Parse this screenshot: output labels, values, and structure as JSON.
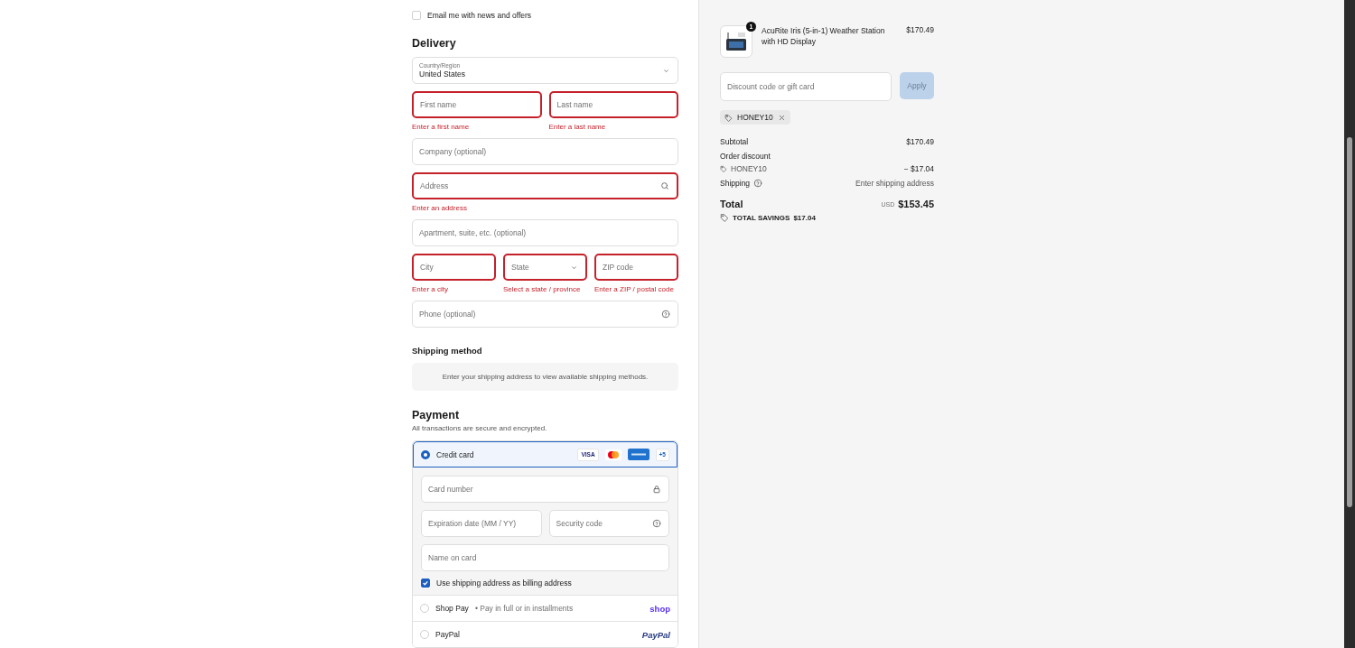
{
  "newsletter": {
    "label": "Email me with news and offers",
    "checked": false
  },
  "delivery": {
    "heading": "Delivery",
    "rows": [
      [
        {
          "kind": "select_labeled",
          "label": "Country/Region",
          "value": "United States",
          "invalid": false
        }
      ],
      [
        {
          "kind": "text",
          "placeholder": "First name",
          "invalid": true,
          "error": "Enter a first name"
        },
        {
          "kind": "text",
          "placeholder": "Last name",
          "invalid": true,
          "error": "Enter a last name"
        }
      ],
      [
        {
          "kind": "text",
          "placeholder": "Company (optional)",
          "invalid": false
        }
      ],
      [
        {
          "kind": "search",
          "placeholder": "Address",
          "invalid": true,
          "error": "Enter an address"
        }
      ],
      [
        {
          "kind": "text",
          "placeholder": "Apartment, suite, etc. (optional)",
          "invalid": false
        }
      ],
      [
        {
          "kind": "text",
          "placeholder": "City",
          "invalid": true,
          "error": "Enter a city"
        },
        {
          "kind": "select",
          "placeholder": "State",
          "invalid": true,
          "error": "Select a state / province"
        },
        {
          "kind": "text",
          "placeholder": "ZIP code",
          "invalid": true,
          "error": "Enter a ZIP / postal code"
        }
      ],
      [
        {
          "kind": "help",
          "placeholder": "Phone (optional)",
          "invalid": false
        }
      ]
    ]
  },
  "shipping_method": {
    "heading": "Shipping method",
    "notice": "Enter your shipping address to view available shipping methods."
  },
  "payment": {
    "heading": "Payment",
    "subtitle": "All transactions are secure and encrypted.",
    "methods": [
      {
        "kind": "card",
        "label": "Credit card",
        "selected": true,
        "brand": "VISA",
        "more": "+5",
        "rows": [
          [
            {
              "kind": "lock",
              "placeholder": "Card number"
            }
          ],
          [
            {
              "kind": "text",
              "placeholder": "Expiration date (MM / YY)"
            },
            {
              "kind": "help",
              "placeholder": "Security code"
            }
          ],
          [
            {
              "kind": "text",
              "placeholder": "Name on card"
            }
          ]
        ],
        "billing": {
          "label": "Use shipping address as billing address",
          "checked": true
        }
      },
      {
        "kind": "shop",
        "label": "Shop Pay",
        "separator": "•",
        "note": "Pay in full or in installments",
        "logo": "shop",
        "selected": false
      },
      {
        "kind": "paypal",
        "label": "PayPal",
        "logo": "PayPal",
        "selected": false
      }
    ]
  },
  "summary": {
    "product": {
      "name": "AcuRite Iris (5-in-1) Weather Station with HD Display",
      "price": "$170.49",
      "quantity": "1"
    },
    "discount": {
      "placeholder": "Discount code or gift card",
      "button": "Apply"
    },
    "applied_code": "HONEY10",
    "lines": [
      {
        "kind": "plain",
        "label": "Subtotal",
        "value": "$170.49"
      },
      {
        "kind": "heading",
        "label": "Order discount"
      },
      {
        "kind": "code",
        "label": "HONEY10",
        "value": "− $17.04"
      },
      {
        "kind": "help",
        "label": "Shipping",
        "value": "Enter shipping address"
      }
    ],
    "total": {
      "label": "Total",
      "currency": "USD",
      "value": "$153.45"
    },
    "savings": {
      "label": "TOTAL SAVINGS",
      "value": "$17.04"
    }
  }
}
